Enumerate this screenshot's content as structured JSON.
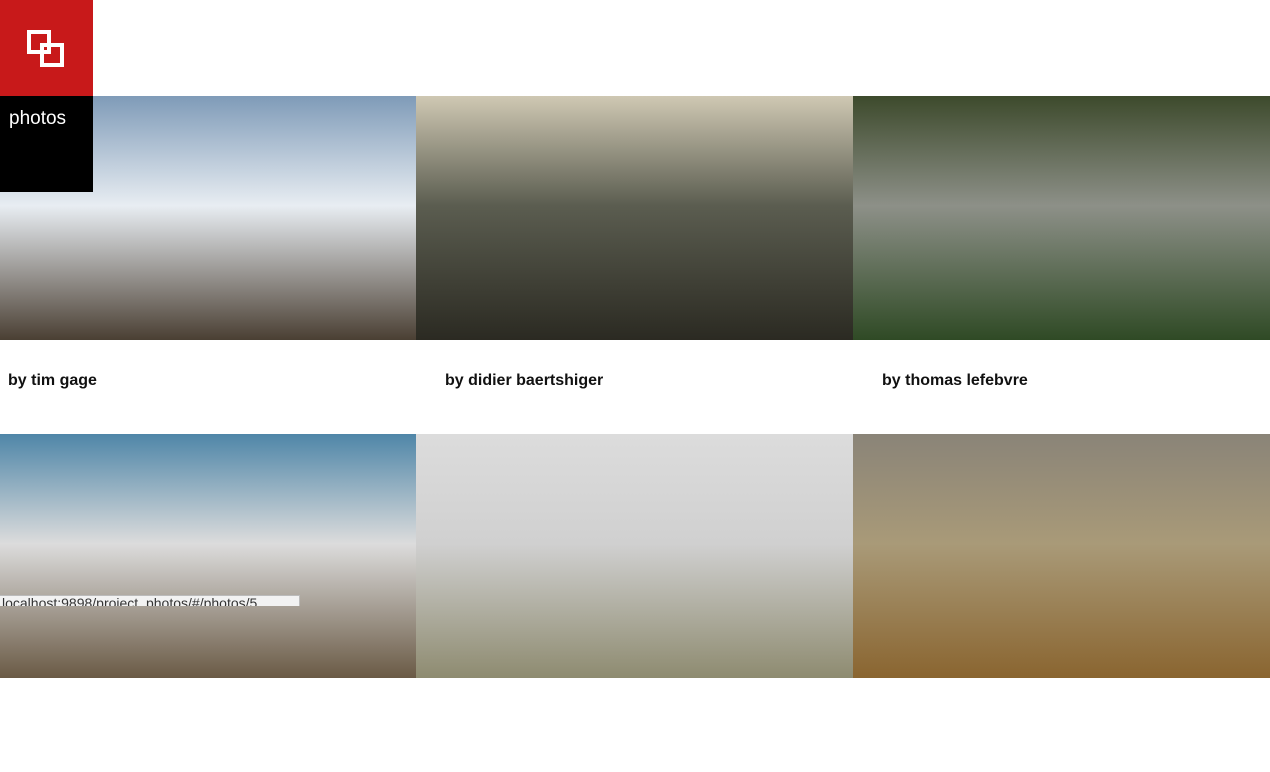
{
  "brand": {
    "color": "#c8191a",
    "icon": "overlapping-squares-icon"
  },
  "nav": {
    "items": [
      {
        "label": "photos"
      }
    ]
  },
  "photos": [
    {
      "caption": "by tim gage",
      "colors": [
        "#7f9bb8",
        "#e8edf2",
        "#4a3f33"
      ]
    },
    {
      "caption": "by didier baertshiger",
      "colors": [
        "#cfc8b3",
        "#5b5d50",
        "#2b2a22"
      ]
    },
    {
      "caption": "by thomas lefebvre",
      "colors": [
        "#3d4a2c",
        "#8d9088",
        "#2f4a25"
      ]
    },
    {
      "caption": "",
      "colors": [
        "#4f86a8",
        "#dcdcdc",
        "#6a5a45"
      ]
    },
    {
      "caption": "",
      "colors": [
        "#dcdcdc",
        "#d0d0d0",
        "#8e8b70"
      ]
    },
    {
      "caption": "",
      "colors": [
        "#8a8478",
        "#a99a78",
        "#8a6530"
      ]
    }
  ],
  "status_bar": {
    "url": "localhost:9898/project_photos/#/photos/5"
  }
}
